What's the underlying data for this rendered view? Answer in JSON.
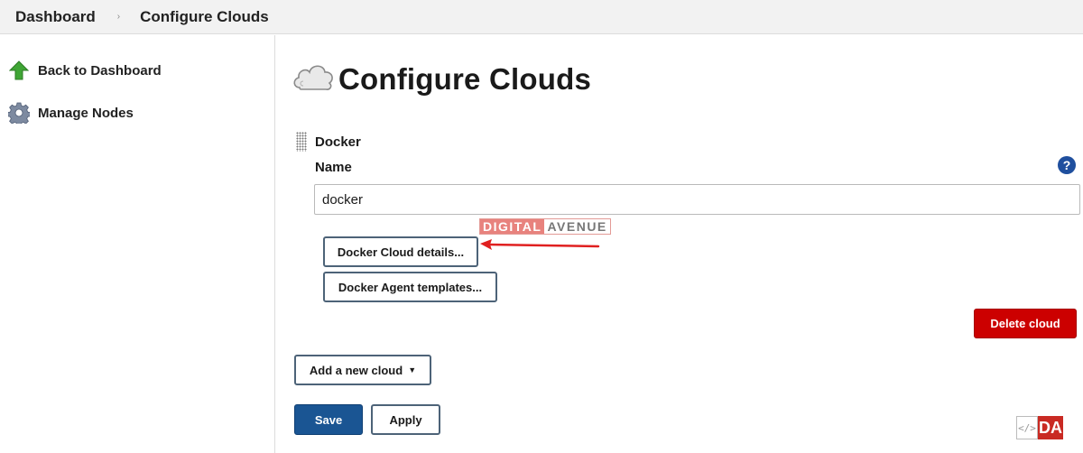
{
  "breadcrumb": {
    "items": [
      "Dashboard",
      "Configure Clouds"
    ],
    "separator": "›"
  },
  "sidepanel": {
    "items": [
      {
        "label": "Back to Dashboard",
        "icon": "green-up-arrow-icon"
      },
      {
        "label": "Manage Nodes",
        "icon": "gear-icon"
      }
    ]
  },
  "main": {
    "title": "Configure Clouds",
    "title_icon": "cloud-icon",
    "cloud": {
      "section_label": "Docker",
      "name_label": "Name",
      "help_glyph": "?",
      "name_value": "docker",
      "details_button": "Docker Cloud details...",
      "templates_button": "Docker Agent templates...",
      "delete_button": "Delete cloud"
    },
    "add_cloud_button": "Add a new cloud",
    "add_cloud_caret": "▼",
    "save_button": "Save",
    "apply_button": "Apply"
  },
  "watermark": {
    "part1": "DIGITAL",
    "part2": "AVENUE"
  },
  "logo": {
    "symbol": "</>",
    "text": "DA"
  },
  "colors": {
    "delete": "#cc0000",
    "save": "#1a5593",
    "help": "#1f4f9e",
    "arrow": "#e02020"
  }
}
